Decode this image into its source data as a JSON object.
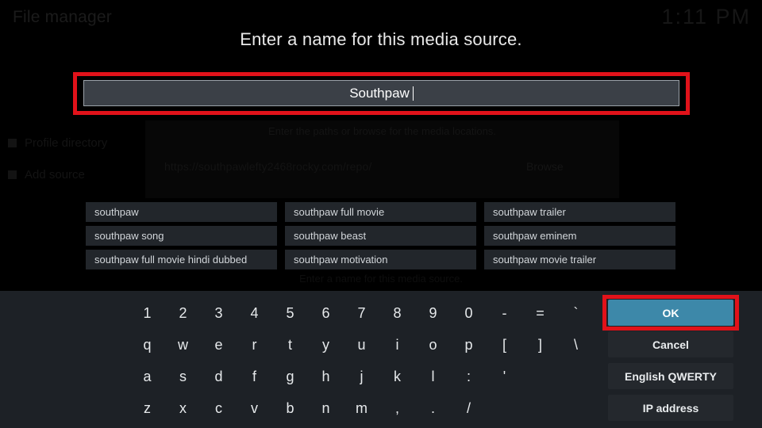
{
  "background": {
    "app_title": "File manager",
    "clock": "1:11 PM",
    "panel_hint": "Enter the paths or browse for the media locations.",
    "url_value": "https://southpawlefty2468rocky.com/repo/",
    "browse_label": "Browse",
    "sidebar": [
      {
        "label": "Profile directory"
      },
      {
        "label": "Add source"
      }
    ],
    "bottom_hint": "Enter a name for this media source."
  },
  "dialog": {
    "heading": "Enter a name for this media source.",
    "input": {
      "value": "Southpaw",
      "caret": "|"
    }
  },
  "suggestions": [
    "southpaw",
    "southpaw full movie",
    "southpaw trailer",
    "southpaw song",
    "southpaw beast",
    "southpaw eminem",
    "southpaw full movie hindi dubbed",
    "southpaw motivation",
    "southpaw movie trailer"
  ],
  "keyboard": {
    "rows": [
      [
        "1",
        "2",
        "3",
        "4",
        "5",
        "6",
        "7",
        "8",
        "9",
        "0",
        "-",
        "=",
        "`"
      ],
      [
        "q",
        "w",
        "e",
        "r",
        "t",
        "y",
        "u",
        "i",
        "o",
        "p",
        "[",
        "]",
        "\\"
      ],
      [
        "a",
        "s",
        "d",
        "f",
        "g",
        "h",
        "j",
        "k",
        "l",
        ":",
        "'"
      ],
      [
        "z",
        "x",
        "c",
        "v",
        "b",
        "n",
        "m",
        ",",
        ".",
        "/"
      ]
    ],
    "buttons": [
      {
        "label": "OK",
        "primary": true
      },
      {
        "label": "Cancel",
        "primary": false
      },
      {
        "label": "English QWERTY",
        "primary": false
      },
      {
        "label": "IP address",
        "primary": false
      }
    ]
  },
  "annotations": {
    "highlight_color": "#e1121a",
    "input_box": "red-highlight-around-name-field",
    "ok_box": "red-highlight-around-ok-button"
  }
}
